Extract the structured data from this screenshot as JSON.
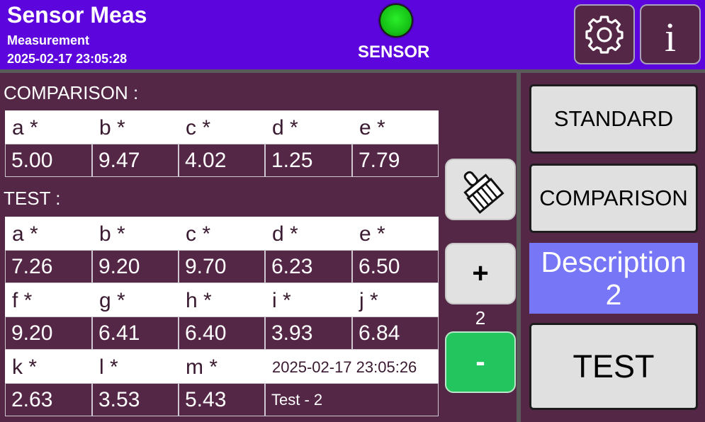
{
  "header": {
    "title": "Sensor Meas",
    "subtitle": "Measurement",
    "datetime": "2025-02-17 23:05:28",
    "sensor_label": "SENSOR",
    "sensor_status_color": "#16c216",
    "settings_icon": "gear-icon",
    "info_icon": "info-icon",
    "info_glyph": "i"
  },
  "comparison": {
    "label": "COMPARISON :",
    "headers": [
      "a *",
      "b *",
      "c *",
      "d *",
      "e *"
    ],
    "values": [
      "5.00",
      "9.47",
      "4.02",
      "1.25",
      "7.79"
    ]
  },
  "test": {
    "label": "TEST :",
    "rows": [
      {
        "headers": [
          "a *",
          "b *",
          "c *",
          "d *",
          "e *"
        ],
        "values": [
          "7.26",
          "9.20",
          "9.70",
          "6.23",
          "6.50"
        ]
      },
      {
        "headers": [
          "f *",
          "g *",
          "h *",
          "i *",
          "j *"
        ],
        "values": [
          "9.20",
          "6.41",
          "6.40",
          "3.93",
          "6.84"
        ]
      },
      {
        "headers": [
          "k *",
          "l *",
          "m *",
          "2025-02-17 23:05:26"
        ],
        "values": [
          "2.63",
          "3.53",
          "5.43",
          "Test - 2"
        ]
      }
    ]
  },
  "controls": {
    "brush_icon": "brush-icon",
    "plus_label": "+",
    "count": "2",
    "minus_label": "-"
  },
  "right_panel": {
    "standard_label": "STANDARD",
    "comparison_label": "COMPARISON",
    "description_line1": "Description",
    "description_line2": "2",
    "test_label": "TEST"
  },
  "colors": {
    "header_bg": "#5c06dd",
    "panel_bg": "#552747",
    "description_bg": "#7676f6",
    "minus_button": "#22c55e"
  }
}
